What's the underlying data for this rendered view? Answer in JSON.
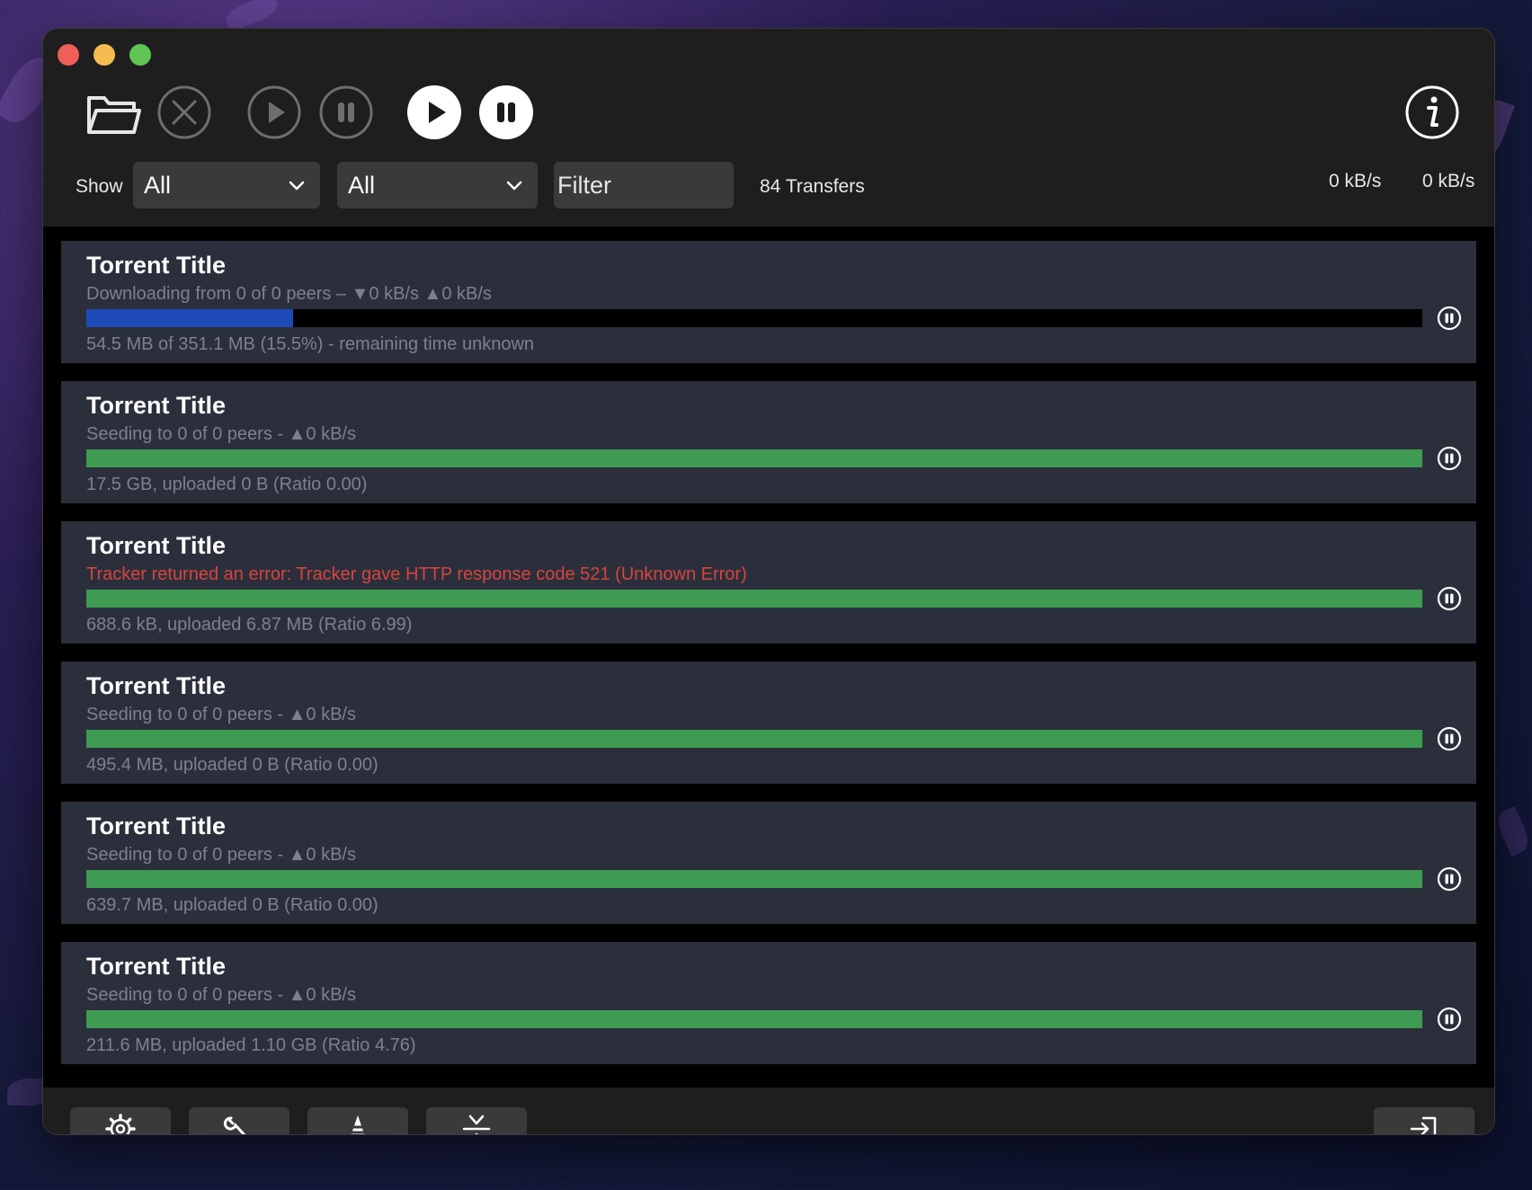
{
  "toolbar": {
    "buttons": [
      {
        "icon": "folder-open-icon"
      },
      {
        "icon": "remove-icon"
      },
      {
        "icon": "resume-icon"
      },
      {
        "icon": "pause-icon"
      },
      {
        "icon": "resume-all-icon"
      },
      {
        "icon": "pause-all-icon"
      },
      {
        "icon": "info-icon"
      }
    ]
  },
  "filterbar": {
    "show_label": "Show",
    "status_select": "All",
    "group_select": "All",
    "filter_placeholder": "Filter",
    "transfer_count": "84 Transfers",
    "download_speed": "0 kB/s",
    "upload_speed": "0 kB/s"
  },
  "colors": {
    "downloading": "#1e4ab8",
    "seeding": "#3f9a52",
    "error": "#d8443c"
  },
  "transfers": [
    {
      "title": "Torrent Title",
      "status": "Downloading from 0 of 0 peers – ▼0 kB/s ▲0 kB/s",
      "info": "54.5 MB of 351.1 MB (15.5%) - remaining time unknown",
      "progress": 0.155,
      "state": "downloading"
    },
    {
      "title": "Torrent Title",
      "status": "Seeding to 0 of 0 peers - ▲0 kB/s",
      "info": "17.5 GB, uploaded 0 B (Ratio 0.00)",
      "progress": 1.0,
      "state": "seeding"
    },
    {
      "title": "Torrent Title",
      "status": "Tracker returned an error: Tracker gave HTTP response code 521 (Unknown Error)",
      "info": "688.6 kB, uploaded 6.87 MB (Ratio 6.99)",
      "progress": 1.0,
      "state": "error"
    },
    {
      "title": "Torrent Title",
      "status": "Seeding to 0 of 0 peers - ▲0 kB/s",
      "info": "495.4 MB, uploaded 0 B (Ratio 0.00)",
      "progress": 1.0,
      "state": "seeding"
    },
    {
      "title": "Torrent Title",
      "status": "Seeding to 0 of 0 peers - ▲0 kB/s",
      "info": "639.7 MB, uploaded 0 B (Ratio 0.00)",
      "progress": 1.0,
      "state": "seeding"
    },
    {
      "title": "Torrent Title",
      "status": "Seeding to 0 of 0 peers - ▲0 kB/s",
      "info": "211.6 MB, uploaded 1.10 GB (Ratio 4.76)",
      "progress": 1.0,
      "state": "seeding"
    }
  ],
  "bottombar": {
    "buttons": [
      {
        "icon": "gear-icon"
      },
      {
        "icon": "wrench-icon"
      },
      {
        "icon": "speed-limit-cone-icon"
      },
      {
        "icon": "collapse-icon"
      },
      {
        "icon": "sign-in-icon"
      }
    ]
  }
}
